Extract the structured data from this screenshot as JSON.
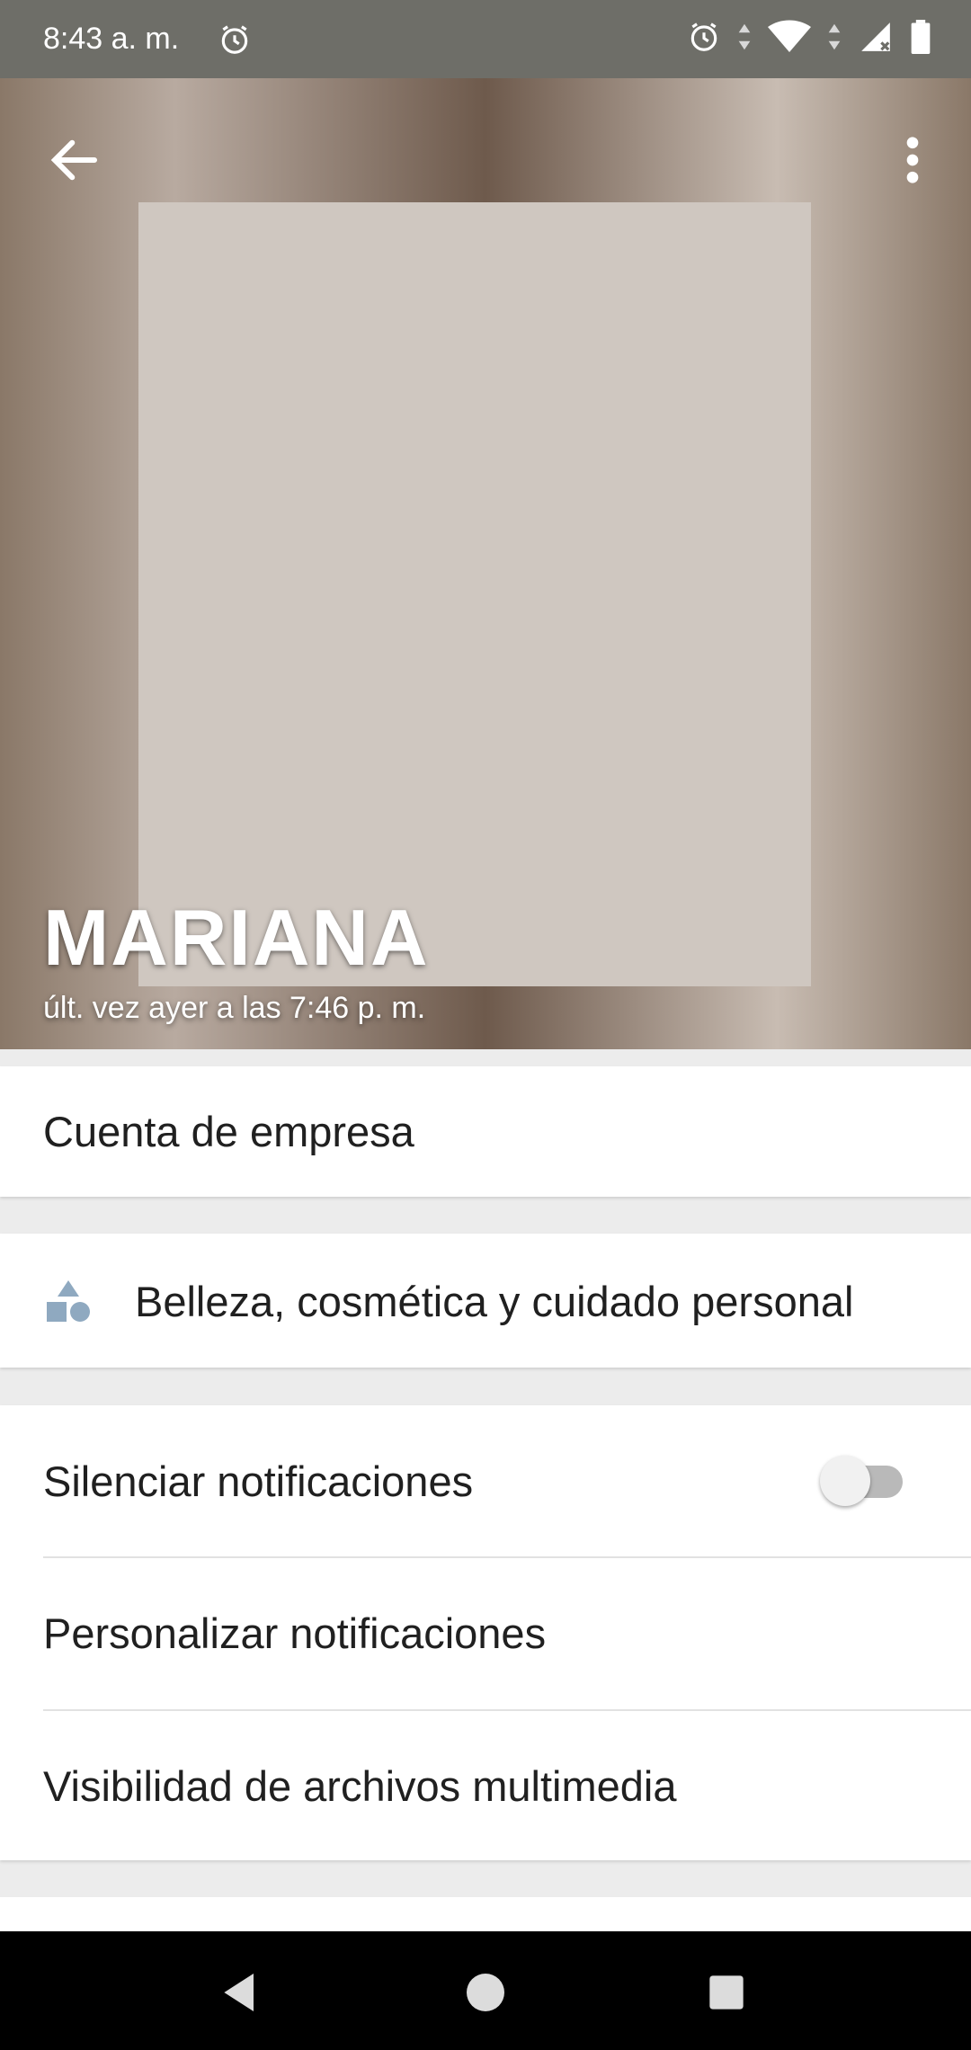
{
  "status_bar": {
    "time": "8:43 a. m."
  },
  "header": {
    "name": "MARIANA",
    "last_seen": "últ. vez ayer a las 7:46 p. m."
  },
  "business": {
    "label": "Cuenta de empresa"
  },
  "category": {
    "icon": "category-shapes-icon",
    "label": "Belleza, cosmética y cuidado personal"
  },
  "settings": {
    "mute_label": "Silenciar notificaciones",
    "mute_enabled": false,
    "custom_label": "Personalizar notificaciones",
    "media_label": "Visibilidad de archivos multimedia"
  },
  "colors": {
    "status_bar": "#6e6e68",
    "icon_blue": "#8fa9c0",
    "nav_bar": "#000000"
  }
}
